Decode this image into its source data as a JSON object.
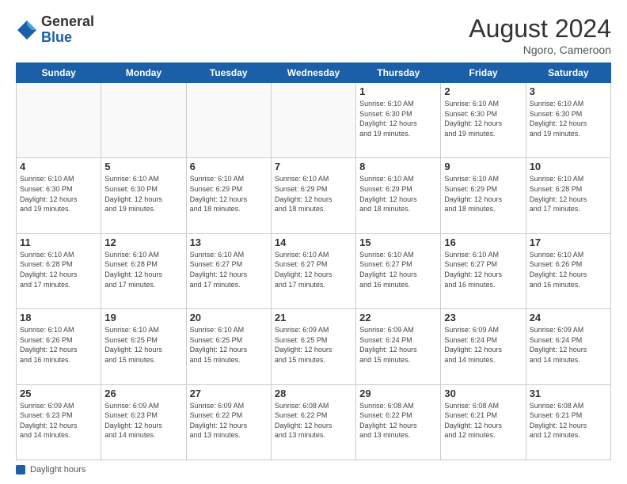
{
  "logo": {
    "general": "General",
    "blue": "Blue"
  },
  "title": "August 2024",
  "location": "Ngoro, Cameroon",
  "days_of_week": [
    "Sunday",
    "Monday",
    "Tuesday",
    "Wednesday",
    "Thursday",
    "Friday",
    "Saturday"
  ],
  "footer_label": "Daylight hours",
  "weeks": [
    [
      {
        "day": "",
        "info": ""
      },
      {
        "day": "",
        "info": ""
      },
      {
        "day": "",
        "info": ""
      },
      {
        "day": "",
        "info": ""
      },
      {
        "day": "1",
        "info": "Sunrise: 6:10 AM\nSunset: 6:30 PM\nDaylight: 12 hours\nand 19 minutes."
      },
      {
        "day": "2",
        "info": "Sunrise: 6:10 AM\nSunset: 6:30 PM\nDaylight: 12 hours\nand 19 minutes."
      },
      {
        "day": "3",
        "info": "Sunrise: 6:10 AM\nSunset: 6:30 PM\nDaylight: 12 hours\nand 19 minutes."
      }
    ],
    [
      {
        "day": "4",
        "info": "Sunrise: 6:10 AM\nSunset: 6:30 PM\nDaylight: 12 hours\nand 19 minutes."
      },
      {
        "day": "5",
        "info": "Sunrise: 6:10 AM\nSunset: 6:30 PM\nDaylight: 12 hours\nand 19 minutes."
      },
      {
        "day": "6",
        "info": "Sunrise: 6:10 AM\nSunset: 6:29 PM\nDaylight: 12 hours\nand 18 minutes."
      },
      {
        "day": "7",
        "info": "Sunrise: 6:10 AM\nSunset: 6:29 PM\nDaylight: 12 hours\nand 18 minutes."
      },
      {
        "day": "8",
        "info": "Sunrise: 6:10 AM\nSunset: 6:29 PM\nDaylight: 12 hours\nand 18 minutes."
      },
      {
        "day": "9",
        "info": "Sunrise: 6:10 AM\nSunset: 6:29 PM\nDaylight: 12 hours\nand 18 minutes."
      },
      {
        "day": "10",
        "info": "Sunrise: 6:10 AM\nSunset: 6:28 PM\nDaylight: 12 hours\nand 17 minutes."
      }
    ],
    [
      {
        "day": "11",
        "info": "Sunrise: 6:10 AM\nSunset: 6:28 PM\nDaylight: 12 hours\nand 17 minutes."
      },
      {
        "day": "12",
        "info": "Sunrise: 6:10 AM\nSunset: 6:28 PM\nDaylight: 12 hours\nand 17 minutes."
      },
      {
        "day": "13",
        "info": "Sunrise: 6:10 AM\nSunset: 6:27 PM\nDaylight: 12 hours\nand 17 minutes."
      },
      {
        "day": "14",
        "info": "Sunrise: 6:10 AM\nSunset: 6:27 PM\nDaylight: 12 hours\nand 17 minutes."
      },
      {
        "day": "15",
        "info": "Sunrise: 6:10 AM\nSunset: 6:27 PM\nDaylight: 12 hours\nand 16 minutes."
      },
      {
        "day": "16",
        "info": "Sunrise: 6:10 AM\nSunset: 6:27 PM\nDaylight: 12 hours\nand 16 minutes."
      },
      {
        "day": "17",
        "info": "Sunrise: 6:10 AM\nSunset: 6:26 PM\nDaylight: 12 hours\nand 16 minutes."
      }
    ],
    [
      {
        "day": "18",
        "info": "Sunrise: 6:10 AM\nSunset: 6:26 PM\nDaylight: 12 hours\nand 16 minutes."
      },
      {
        "day": "19",
        "info": "Sunrise: 6:10 AM\nSunset: 6:25 PM\nDaylight: 12 hours\nand 15 minutes."
      },
      {
        "day": "20",
        "info": "Sunrise: 6:10 AM\nSunset: 6:25 PM\nDaylight: 12 hours\nand 15 minutes."
      },
      {
        "day": "21",
        "info": "Sunrise: 6:09 AM\nSunset: 6:25 PM\nDaylight: 12 hours\nand 15 minutes."
      },
      {
        "day": "22",
        "info": "Sunrise: 6:09 AM\nSunset: 6:24 PM\nDaylight: 12 hours\nand 15 minutes."
      },
      {
        "day": "23",
        "info": "Sunrise: 6:09 AM\nSunset: 6:24 PM\nDaylight: 12 hours\nand 14 minutes."
      },
      {
        "day": "24",
        "info": "Sunrise: 6:09 AM\nSunset: 6:24 PM\nDaylight: 12 hours\nand 14 minutes."
      }
    ],
    [
      {
        "day": "25",
        "info": "Sunrise: 6:09 AM\nSunset: 6:23 PM\nDaylight: 12 hours\nand 14 minutes."
      },
      {
        "day": "26",
        "info": "Sunrise: 6:09 AM\nSunset: 6:23 PM\nDaylight: 12 hours\nand 14 minutes."
      },
      {
        "day": "27",
        "info": "Sunrise: 6:09 AM\nSunset: 6:22 PM\nDaylight: 12 hours\nand 13 minutes."
      },
      {
        "day": "28",
        "info": "Sunrise: 6:08 AM\nSunset: 6:22 PM\nDaylight: 12 hours\nand 13 minutes."
      },
      {
        "day": "29",
        "info": "Sunrise: 6:08 AM\nSunset: 6:22 PM\nDaylight: 12 hours\nand 13 minutes."
      },
      {
        "day": "30",
        "info": "Sunrise: 6:08 AM\nSunset: 6:21 PM\nDaylight: 12 hours\nand 12 minutes."
      },
      {
        "day": "31",
        "info": "Sunrise: 6:08 AM\nSunset: 6:21 PM\nDaylight: 12 hours\nand 12 minutes."
      }
    ]
  ]
}
